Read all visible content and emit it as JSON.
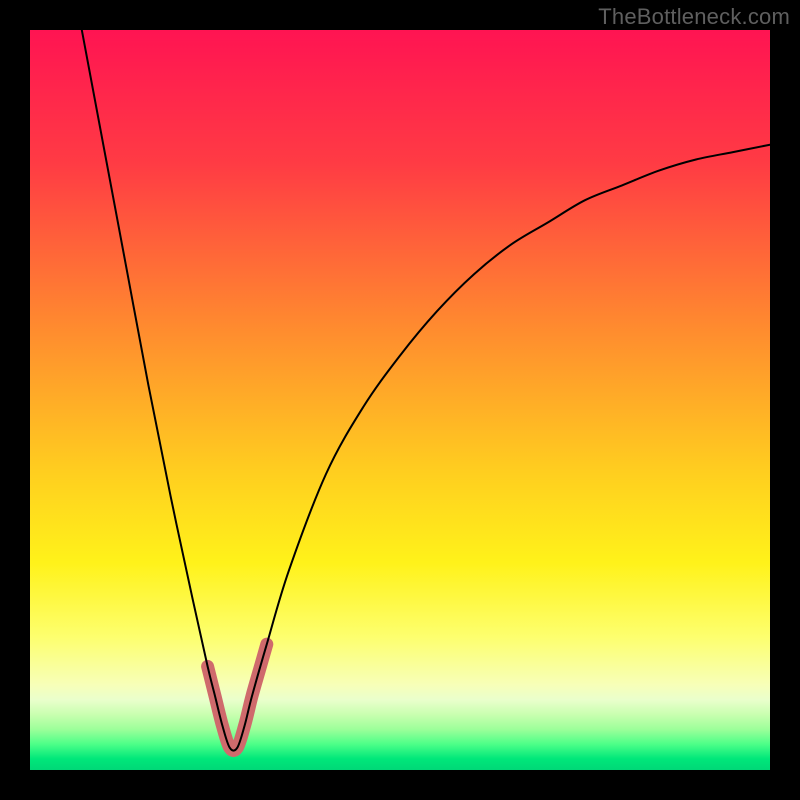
{
  "watermark": "TheBottleneck.com",
  "chart_data": {
    "type": "line",
    "title": "",
    "xlabel": "",
    "ylabel": "",
    "xlim": [
      0,
      100
    ],
    "ylim": [
      0,
      100
    ],
    "grid": false,
    "legend": false,
    "description": "A V-shaped curve plotting bottleneck mismatch. Y is high near the left edge, drops to near-zero at a sweet spot around x≈27, and rises again toward the right. The short flat segment at the valley bottom is highlighted with a thick salmon stroke. Background is a vertical rainbow gradient (red→orange→yellow→green bands).",
    "series": [
      {
        "name": "curve",
        "x": [
          7,
          10,
          13,
          16,
          19,
          22,
          24,
          25,
          26,
          27,
          28,
          29,
          30,
          32,
          35,
          40,
          45,
          50,
          55,
          60,
          65,
          70,
          75,
          80,
          85,
          90,
          95,
          100
        ],
        "y": [
          100,
          84,
          68,
          52,
          37,
          23,
          14,
          10,
          6,
          3,
          3,
          6,
          10,
          17,
          27,
          40,
          49,
          56,
          62,
          67,
          71,
          74,
          77,
          79,
          81,
          82.5,
          83.5,
          84.5
        ]
      }
    ],
    "highlight": {
      "name": "sweet-spot-band",
      "color": "#cf6a6c",
      "x": [
        24,
        25,
        26,
        27,
        28,
        29,
        30,
        31,
        32
      ],
      "y": [
        14,
        10,
        6,
        3,
        3,
        6,
        10,
        13.5,
        17
      ]
    },
    "gradient_stops": [
      {
        "offset": 0,
        "color": "#ff1452"
      },
      {
        "offset": 0.18,
        "color": "#ff3b44"
      },
      {
        "offset": 0.4,
        "color": "#ff8a2f"
      },
      {
        "offset": 0.6,
        "color": "#ffcf1f"
      },
      {
        "offset": 0.72,
        "color": "#fff21a"
      },
      {
        "offset": 0.82,
        "color": "#fdff6e"
      },
      {
        "offset": 0.885,
        "color": "#f7ffb8"
      },
      {
        "offset": 0.905,
        "color": "#eaffcc"
      },
      {
        "offset": 0.925,
        "color": "#c9ffb0"
      },
      {
        "offset": 0.945,
        "color": "#9cff9a"
      },
      {
        "offset": 0.965,
        "color": "#4dff88"
      },
      {
        "offset": 0.985,
        "color": "#00e77a"
      },
      {
        "offset": 1.0,
        "color": "#00d877"
      }
    ]
  }
}
